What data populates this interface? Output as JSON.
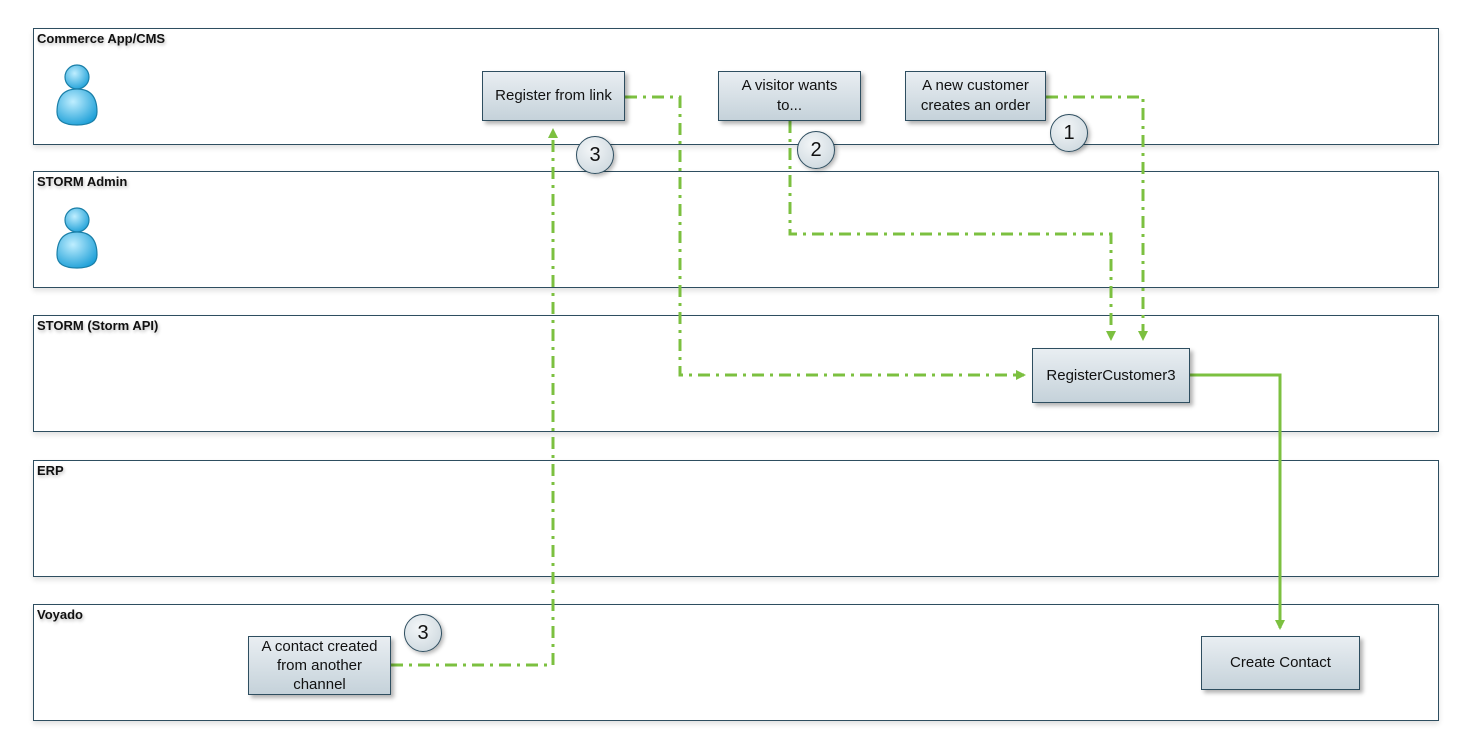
{
  "diagram": {
    "lanes": [
      {
        "id": "commerce",
        "title": "Commerce App/CMS",
        "has_actor": true
      },
      {
        "id": "storm-admin",
        "title": "STORM Admin",
        "has_actor": true
      },
      {
        "id": "storm-api",
        "title": "STORM (Storm API)",
        "has_actor": false
      },
      {
        "id": "erp",
        "title": "ERP",
        "has_actor": false
      },
      {
        "id": "voyado",
        "title": "Voyado",
        "has_actor": false
      }
    ],
    "nodes": {
      "register_from_link": "Register from link",
      "visitor_wants_line1": "A visitor wants",
      "visitor_wants_line2": "to...",
      "new_customer_line1": "A new customer",
      "new_customer_line2": "creates an order",
      "register_customer3": "RegisterCustomer3",
      "contact_other_line1": "A contact created",
      "contact_other_line2": "from another",
      "contact_other_line3": "channel",
      "create_contact": "Create Contact"
    },
    "badges": {
      "step_one": "1",
      "step_two": "2",
      "step_three_top": "3",
      "step_three_bottom": "3"
    },
    "colors": {
      "lane_border": "#2e4e60",
      "connector_green": "#7cc040",
      "actor_blue": "#29a8e0"
    }
  }
}
